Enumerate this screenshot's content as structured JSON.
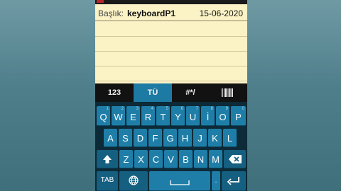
{
  "note": {
    "title_label": "Başlık:",
    "title_value": "keyboardP1",
    "date": "15-06-2020"
  },
  "tabs": [
    {
      "label": "123",
      "active": false
    },
    {
      "label": "TÜ",
      "active": true
    },
    {
      "label": "#*/",
      "active": false
    },
    {
      "label": "barcode-icon",
      "active": false
    }
  ],
  "keyboard": {
    "row1": [
      {
        "label": "Q",
        "hint": "1"
      },
      {
        "label": "W",
        "hint": "2"
      },
      {
        "label": "E",
        "hint": "3"
      },
      {
        "label": "R",
        "hint": "4"
      },
      {
        "label": "T",
        "hint": "5"
      },
      {
        "label": "Y",
        "hint": "6"
      },
      {
        "label": "U",
        "hint": "7"
      },
      {
        "label": "İ",
        "hint": "8"
      },
      {
        "label": "O",
        "hint": "9"
      },
      {
        "label": "P",
        "hint": "0"
      }
    ],
    "row2": [
      {
        "label": "A",
        "hint": ""
      },
      {
        "label": "S",
        "hint": ""
      },
      {
        "label": "D",
        "hint": ""
      },
      {
        "label": "F",
        "hint": ""
      },
      {
        "label": "G",
        "hint": ""
      },
      {
        "label": "H",
        "hint": ""
      },
      {
        "label": "J",
        "hint": ""
      },
      {
        "label": "K",
        "hint": ""
      },
      {
        "label": "L",
        "hint": ""
      }
    ],
    "row3": [
      {
        "label": "Z",
        "hint": ""
      },
      {
        "label": "X",
        "hint": ""
      },
      {
        "label": "C",
        "hint": ""
      },
      {
        "label": "V",
        "hint": ""
      },
      {
        "label": "B",
        "hint": ""
      },
      {
        "label": "N",
        "hint": ""
      },
      {
        "label": "M",
        "hint": ""
      }
    ],
    "shift_icon": "shift-arrow-icon",
    "backspace_icon": "backspace-icon",
    "tab_label": "TAB",
    "globe_icon": "globe-icon",
    "enter_icon": "enter-icon"
  }
}
